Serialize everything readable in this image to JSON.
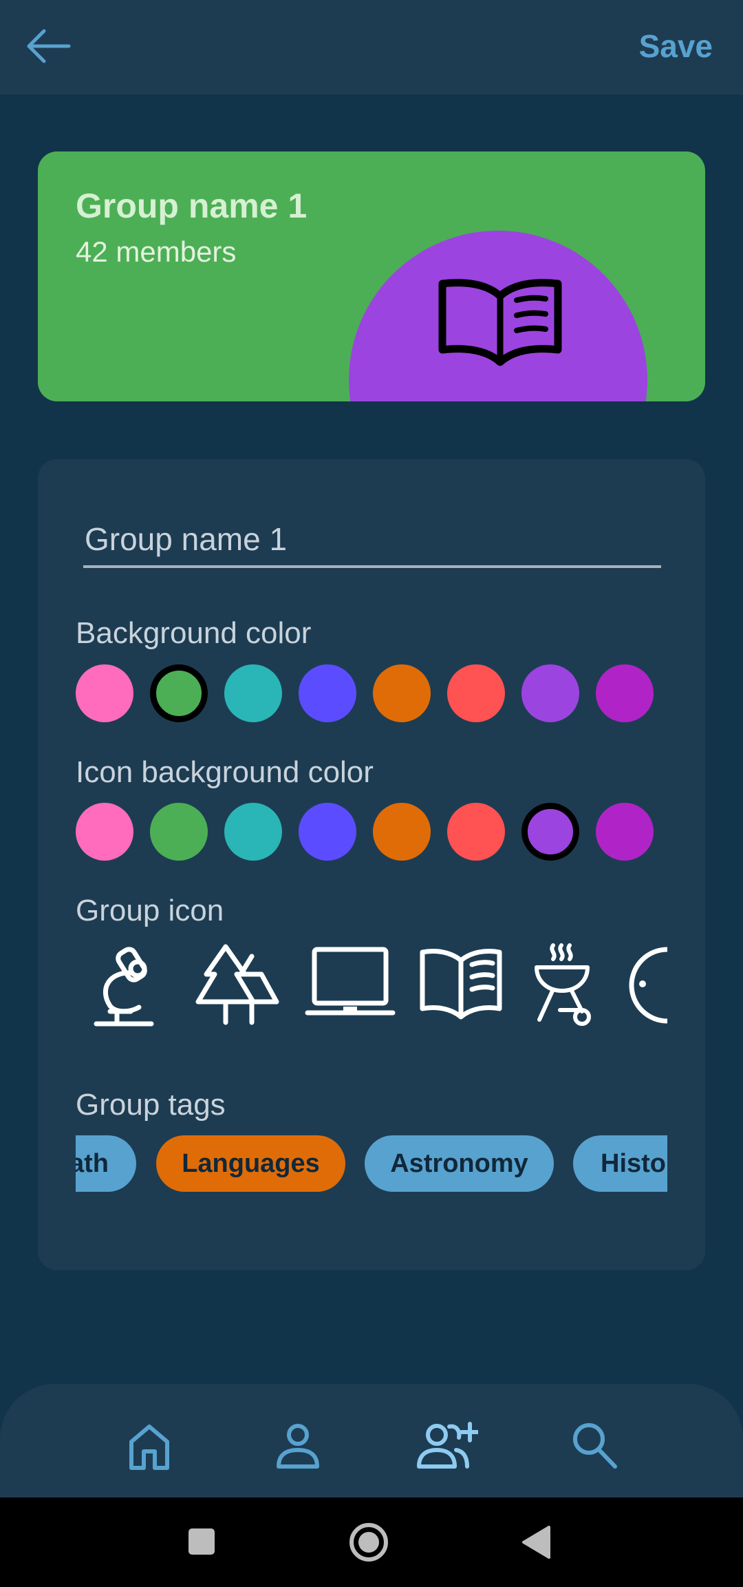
{
  "header": {
    "back_icon": "arrow-left-icon",
    "save_label": "Save"
  },
  "preview": {
    "title": "Group name 1",
    "members": "42 members",
    "background_color": "#4caf55",
    "icon_background_color": "#9c44e0",
    "icon": "book-icon"
  },
  "form": {
    "name_value": "Group name 1",
    "background_label": "Background color",
    "background_colors": [
      "#ff6bbd",
      "#4caf55",
      "#2ab6b6",
      "#5b4dff",
      "#e06c08",
      "#ff5252",
      "#9c44e0",
      "#b024c7"
    ],
    "background_selected_index": 1,
    "icon_bg_label": "Icon background color",
    "icon_bg_colors": [
      "#ff6bbd",
      "#4caf55",
      "#2ab6b6",
      "#5b4dff",
      "#e06c08",
      "#ff5252",
      "#9c44e0",
      "#b024c7"
    ],
    "icon_bg_selected_index": 6,
    "icon_label": "Group icon",
    "icons": [
      "microscope-icon",
      "trees-icon",
      "laptop-icon",
      "book-icon",
      "grill-icon",
      "partial-icon"
    ],
    "tags_label": "Group tags",
    "tags": [
      {
        "label": "ath",
        "selected": false
      },
      {
        "label": "Languages",
        "selected": true
      },
      {
        "label": "Astronomy",
        "selected": false
      },
      {
        "label": "Histor",
        "selected": false
      }
    ],
    "tag_selected_color": "#e06c08",
    "tag_default_color": "#58a2cf"
  },
  "nav": {
    "items": [
      "home-icon",
      "profile-icon",
      "add-group-icon",
      "search-icon"
    ],
    "active_index": 2
  },
  "system_nav": [
    "square-icon",
    "circle-icon",
    "triangle-back-icon"
  ]
}
